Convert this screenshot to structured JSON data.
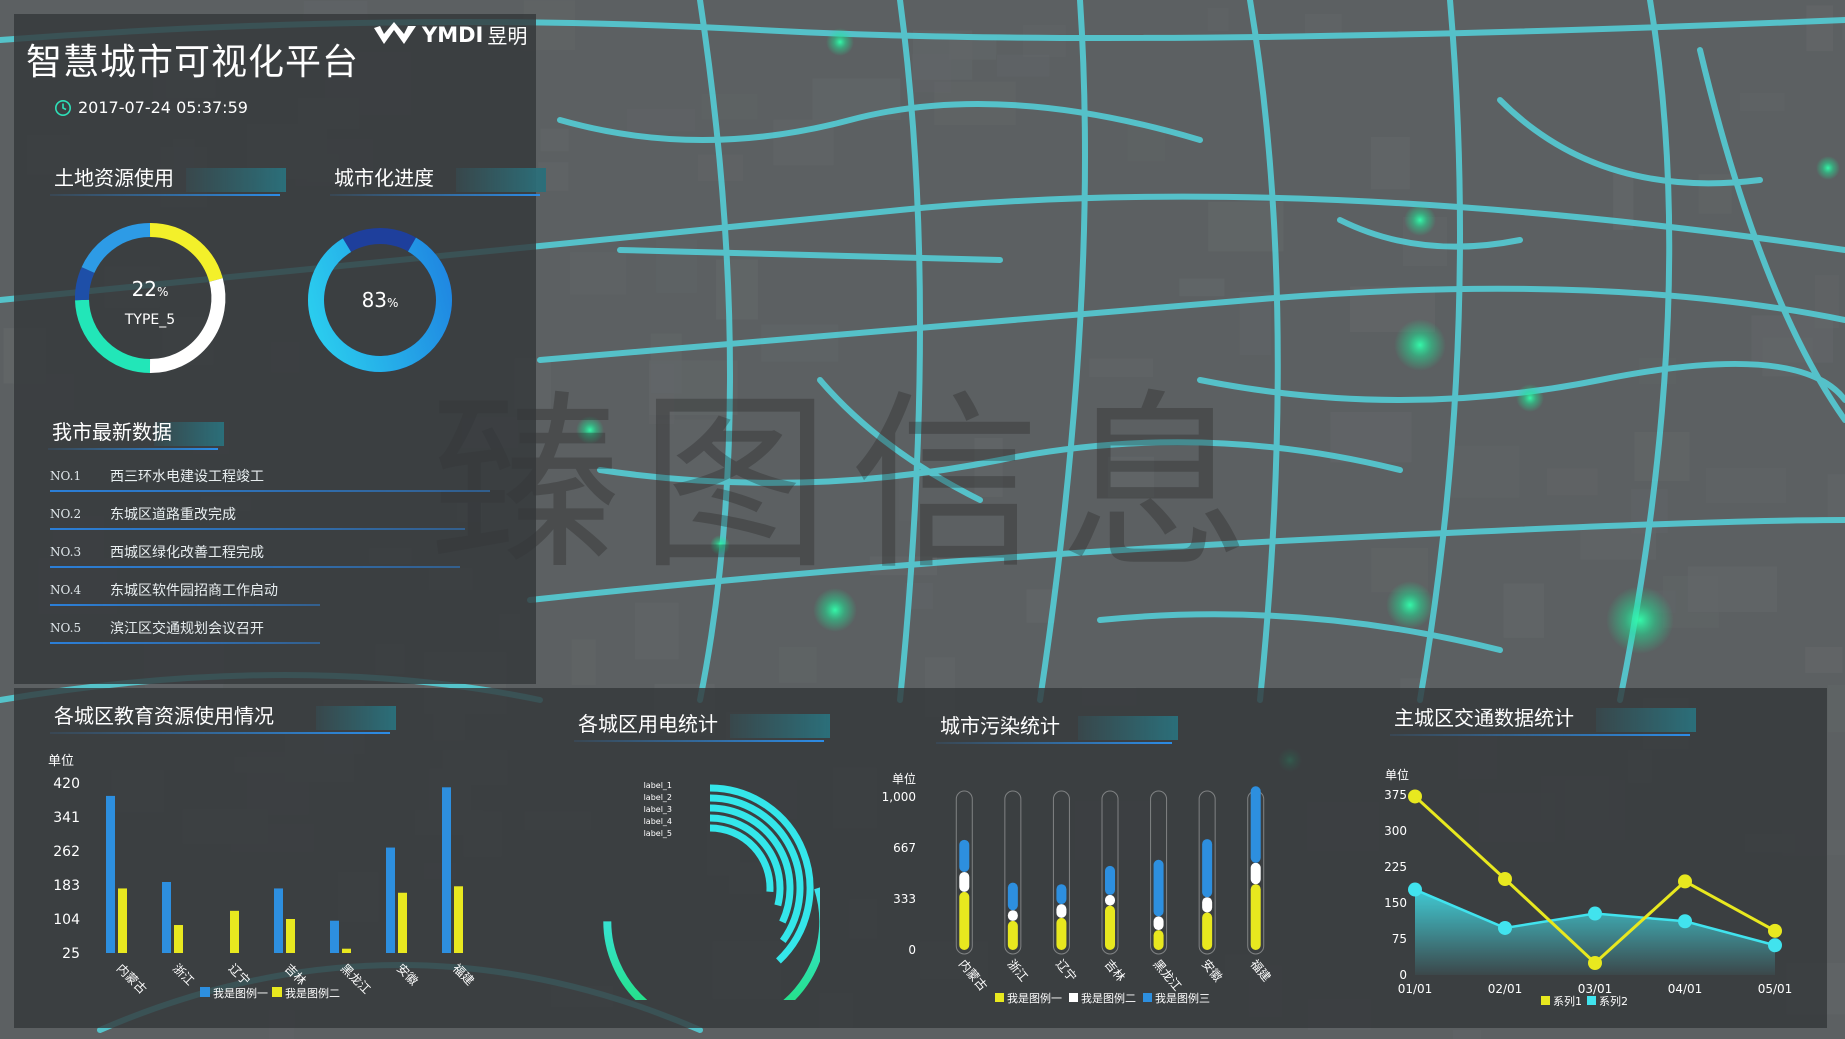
{
  "header": {
    "title": "智慧城市可视化平台",
    "datetime": "2017-07-24 05:37:59",
    "logo_text": "YMDI",
    "logo_cn": "昱明",
    "watermark": "臻图信息"
  },
  "sections": {
    "land": "土地资源使用",
    "urban": "城市化进度",
    "news": "我市最新数据",
    "education": "各城区教育资源使用情况",
    "power": "各城区用电统计",
    "pollution": "城市污染统计",
    "traffic": "主城区交通数据统计"
  },
  "land_gauge": {
    "value": "22",
    "unit": "%",
    "label": "TYPE_5"
  },
  "urban_gauge": {
    "value": "83",
    "unit": "%",
    "fraction": 0.83
  },
  "news": [
    {
      "no": "NO.1",
      "text": "西三环水电建设工程竣工"
    },
    {
      "no": "NO.2",
      "text": "东城区道路重改完成"
    },
    {
      "no": "NO.3",
      "text": "西城区绿化改善工程完成"
    },
    {
      "no": "NO.4",
      "text": "东城区软件园招商工作启动"
    },
    {
      "no": "NO.5",
      "text": "滨江区交通规划会议召开"
    }
  ],
  "colors": {
    "blue": "#2d8fdf",
    "yellow": "#e8e81f",
    "cyan": "#43e6ee",
    "green": "#17e6a6",
    "white": "#ffffff",
    "road": "#54d3dc"
  },
  "chart_data": [
    {
      "id": "education",
      "type": "bar",
      "ylabel": "单位",
      "yticks": [
        "420",
        "341",
        "262",
        "183",
        "104",
        "25"
      ],
      "ylim": [
        25,
        420
      ],
      "categories": [
        "内蒙古",
        "浙江",
        "辽宁",
        "吉林",
        "黑龙江",
        "安徽",
        "福建"
      ],
      "series": [
        {
          "name": "我是图例一",
          "values": [
            390,
            190,
            0,
            175,
            100,
            270,
            410
          ]
        },
        {
          "name": "我是图例二",
          "values": [
            175,
            90,
            123,
            104,
            35,
            165,
            180
          ]
        }
      ]
    },
    {
      "id": "power",
      "type": "pie",
      "labels": [
        "label_1",
        "label_2",
        "label_3",
        "label_4",
        "label_5"
      ],
      "values": [
        0.38,
        0.35,
        0.32,
        0.29,
        0.26,
        0.7
      ]
    },
    {
      "id": "pollution",
      "type": "bar",
      "ylabel": "单位",
      "yticks": [
        "1,000",
        "667",
        "333",
        "0"
      ],
      "ylim": [
        0,
        1000
      ],
      "categories": [
        "内蒙古",
        "浙江",
        "辽宁",
        "吉林",
        "黑龙江",
        "安徽",
        "福建"
      ],
      "series": [
        {
          "name": "我是图例一",
          "values": [
            380,
            190,
            210,
            290,
            130,
            245,
            430
          ]
        },
        {
          "name": "我是图例二",
          "values": [
            130,
            70,
            90,
            70,
            90,
            100,
            140
          ]
        },
        {
          "name": "我是图例三",
          "values": [
            210,
            180,
            130,
            190,
            370,
            380,
            500
          ]
        }
      ]
    },
    {
      "id": "traffic",
      "type": "line",
      "ylabel": "单位",
      "yticks": [
        "375",
        "300",
        "225",
        "150",
        "75",
        "0"
      ],
      "ylim": [
        0,
        375
      ],
      "categories": [
        "01/01",
        "02/01",
        "03/01",
        "04/01",
        "05/01"
      ],
      "series": [
        {
          "name": "系列1",
          "values": [
            372,
            200,
            25,
            195,
            92
          ]
        },
        {
          "name": "系列2",
          "values": [
            178,
            98,
            128,
            112,
            62
          ]
        }
      ]
    }
  ]
}
